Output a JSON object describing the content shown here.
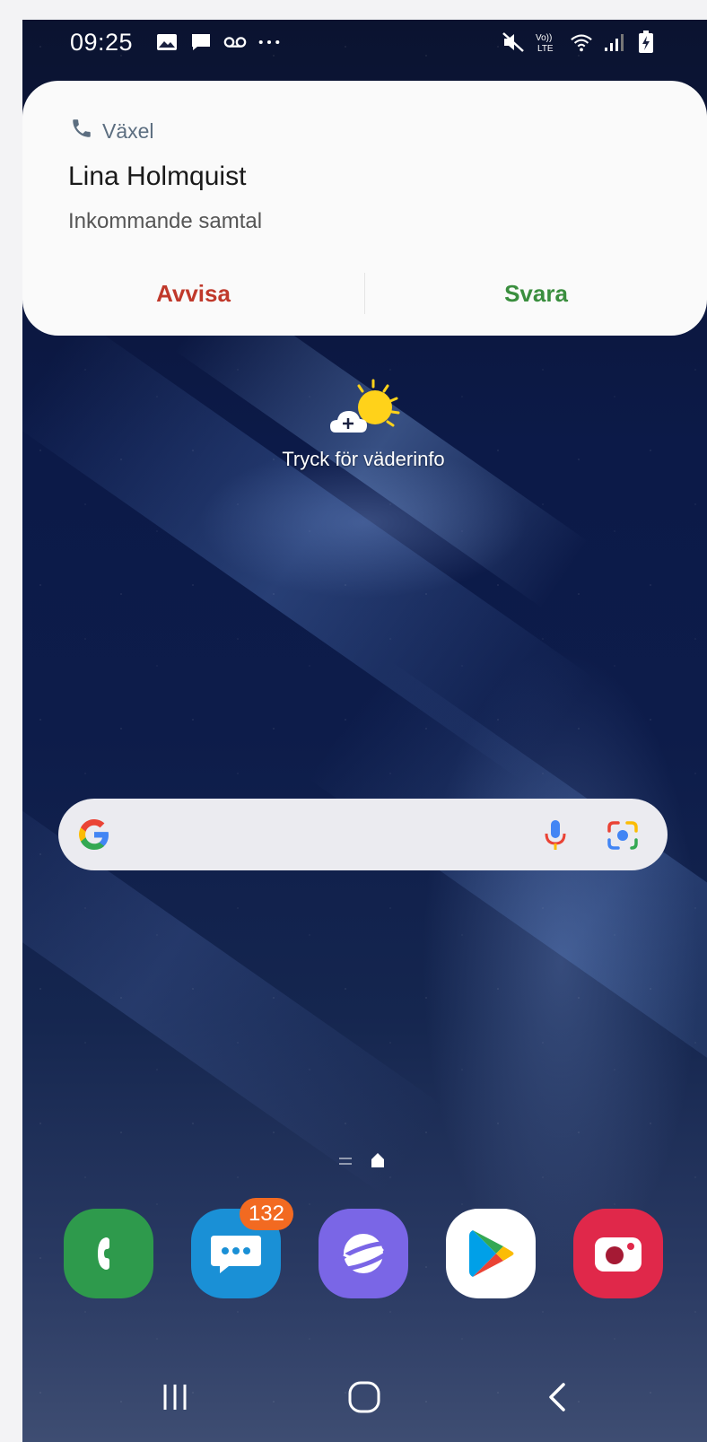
{
  "status_bar": {
    "time": "09:25",
    "left_icons": [
      "gallery-icon",
      "chat-icon",
      "voicemail-icon",
      "more-dots-icon"
    ],
    "right_icons": [
      "mute-icon",
      "volte-lte-icon",
      "wifi-icon",
      "signal-icon",
      "battery-charging-icon"
    ]
  },
  "notification": {
    "app_name": "Växel",
    "caller_name": "Lina Holmquist",
    "subtitle": "Inkommande samtal",
    "decline_label": "Avvisa",
    "accept_label": "Svara",
    "colors": {
      "decline": "#c0392b",
      "accept": "#3a8e3e"
    }
  },
  "weather": {
    "label": "Tryck för väderinfo"
  },
  "search": {
    "mic": "mic-icon",
    "lens": "google-lens-icon"
  },
  "dock": {
    "apps": [
      {
        "name": "Phone",
        "color": "#2e9a4c"
      },
      {
        "name": "Messages",
        "color": "#1a90d6",
        "badge": "132"
      },
      {
        "name": "Internet",
        "color": "#7a66e6"
      },
      {
        "name": "Play Store",
        "color": "#ffffff"
      },
      {
        "name": "Screen Recorder",
        "color": "#e0284a"
      }
    ]
  },
  "navbar": {
    "buttons": [
      "recents-icon",
      "home-icon",
      "back-icon"
    ]
  }
}
